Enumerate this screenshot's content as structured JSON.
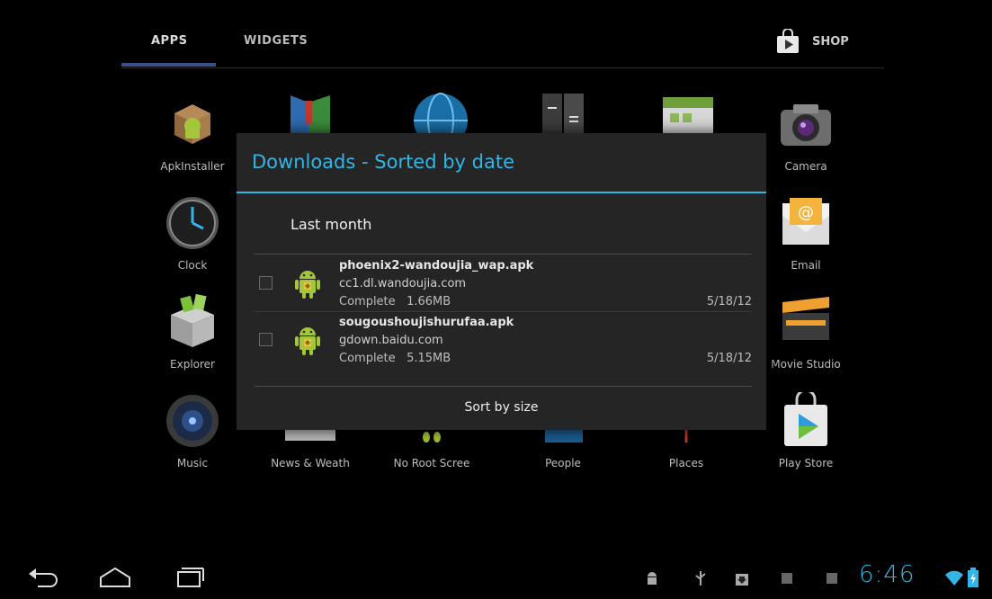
{
  "tabs": {
    "apps": "APPS",
    "widgets": "WIDGETS",
    "shop": "SHOP"
  },
  "apps": [
    {
      "label": "ApkInstaller",
      "icon": "apk-installer-icon"
    },
    {
      "label": "Clock",
      "icon": "clock-icon"
    },
    {
      "label": "Explorer",
      "icon": "explorer-icon"
    },
    {
      "label": "Music",
      "icon": "music-icon"
    },
    {
      "label": "News & Weath",
      "icon": "news-weather-icon"
    },
    {
      "label": "No Root Scree",
      "icon": "no-root-screenshot-icon"
    },
    {
      "label": "People",
      "icon": "people-icon"
    },
    {
      "label": "Places",
      "icon": "places-icon"
    },
    {
      "label": "Camera",
      "icon": "camera-icon"
    },
    {
      "label": "Email",
      "icon": "email-icon"
    },
    {
      "label": "Movie Studio",
      "icon": "movie-studio-icon"
    },
    {
      "label": "Play Store",
      "icon": "play-store-icon"
    }
  ],
  "dialog": {
    "title": "Downloads - Sorted by date",
    "section": "Last month",
    "items": [
      {
        "name": "phoenix2-wandoujia_wap.apk",
        "host": "cc1.dl.wandoujia.com",
        "status": "Complete",
        "size": "1.66MB",
        "date": "5/18/12"
      },
      {
        "name": "sougoushoujishurufaa.apk",
        "host": "gdown.baidu.com",
        "status": "Complete",
        "size": "5.15MB",
        "date": "5/18/12"
      }
    ],
    "sort_button": "Sort by size"
  },
  "system": {
    "time": "6:46"
  },
  "colors": {
    "accent": "#33b5e5",
    "dialog_bg": "#252525",
    "tab_indicator": "#3a4f8a",
    "android_green": "#a4c639"
  }
}
